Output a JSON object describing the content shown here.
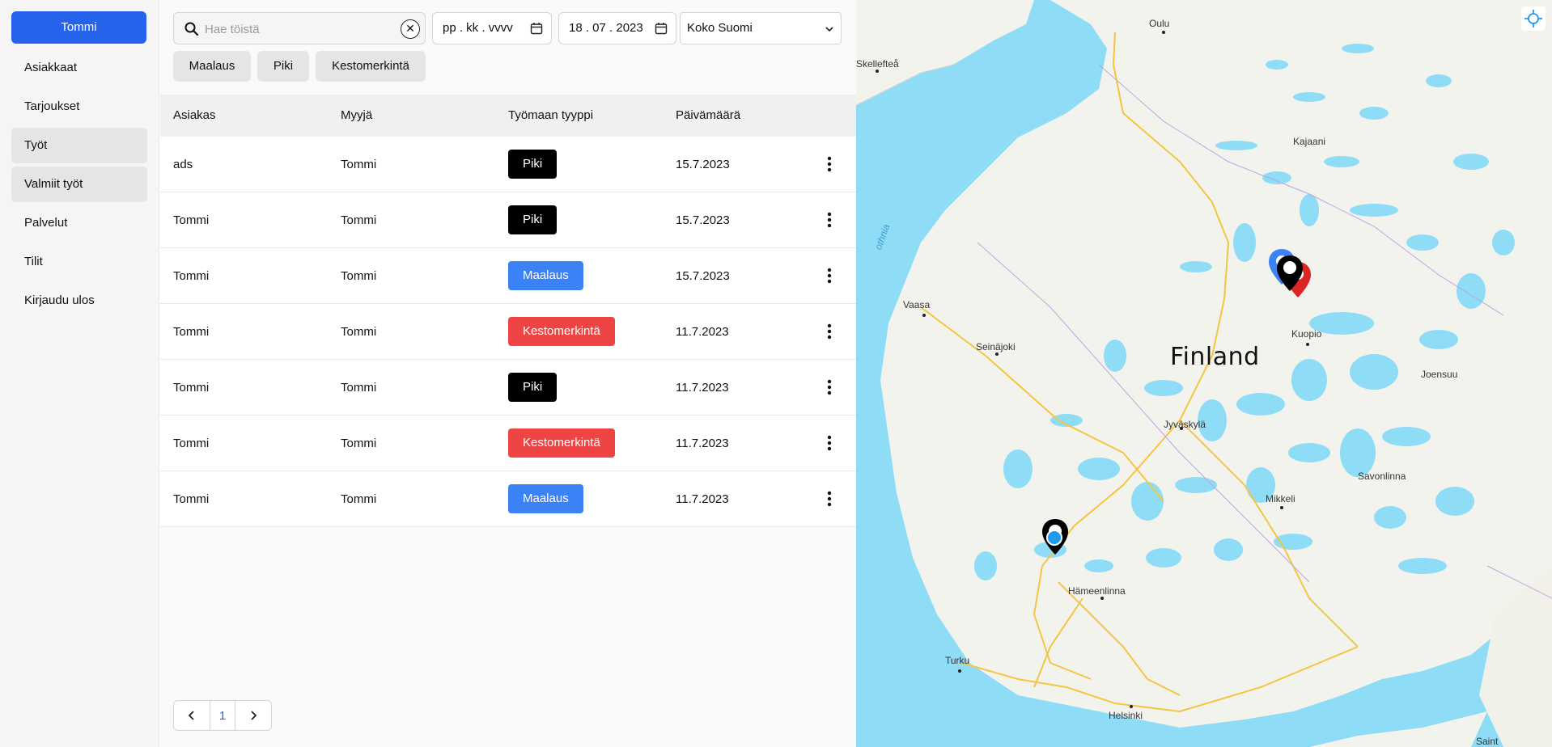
{
  "sidebar": {
    "user_button": "Tommi",
    "items": [
      {
        "label": "Asiakkaat",
        "active": false
      },
      {
        "label": "Tarjoukset",
        "active": false
      },
      {
        "label": "Työt",
        "active": true
      },
      {
        "label": "Valmiit työt",
        "active": true
      },
      {
        "label": "Palvelut",
        "active": false
      },
      {
        "label": "Tilit",
        "active": false
      },
      {
        "label": "Kirjaudu ulos",
        "active": false
      }
    ]
  },
  "filters": {
    "search_placeholder": "Hae töistä",
    "search_value": "",
    "start_date": "pp . kk . vvvv",
    "end_date": "18 . 07 . 2023",
    "region_selected": "Koko Suomi",
    "chips": [
      "Maalaus",
      "Piki",
      "Kestomerkintä"
    ]
  },
  "table": {
    "headers": [
      "Asiakas",
      "Myyjä",
      "Työmaan tyyppi",
      "Päivämäärä"
    ],
    "rows": [
      {
        "asiakas": "ads",
        "myyja": "Tommi",
        "tyyppi": "Piki",
        "pvm": "15.7.2023"
      },
      {
        "asiakas": "Tommi",
        "myyja": "Tommi",
        "tyyppi": "Piki",
        "pvm": "15.7.2023"
      },
      {
        "asiakas": "Tommi",
        "myyja": "Tommi",
        "tyyppi": "Maalaus",
        "pvm": "15.7.2023"
      },
      {
        "asiakas": "Tommi",
        "myyja": "Tommi",
        "tyyppi": "Kestomerkintä",
        "pvm": "11.7.2023"
      },
      {
        "asiakas": "Tommi",
        "myyja": "Tommi",
        "tyyppi": "Piki",
        "pvm": "11.7.2023"
      },
      {
        "asiakas": "Tommi",
        "myyja": "Tommi",
        "tyyppi": "Kestomerkintä",
        "pvm": "11.7.2023"
      },
      {
        "asiakas": "Tommi",
        "myyja": "Tommi",
        "tyyppi": "Maalaus",
        "pvm": "11.7.2023"
      }
    ]
  },
  "tag_colors": {
    "Piki": "#000000",
    "Maalaus": "#3b82f6",
    "Kestomerkintä": "#ef4444"
  },
  "pagination": {
    "current_page": "1"
  },
  "map": {
    "country_label": "Finland",
    "gulf_label": "othnia",
    "cities": [
      "Oulu",
      "Skellefteå",
      "Kajaani",
      "Vaasa",
      "Seinäjoki",
      "Kuopio",
      "Joensuu",
      "Jyväskylä",
      "Savonlinna",
      "Mikkeli",
      "Hämeenlinna",
      "Turku",
      "Helsinki",
      "Saint"
    ]
  },
  "colors": {
    "accent": "#2563eb",
    "water": "#8fdcf7",
    "land": "#f4f4ef"
  }
}
